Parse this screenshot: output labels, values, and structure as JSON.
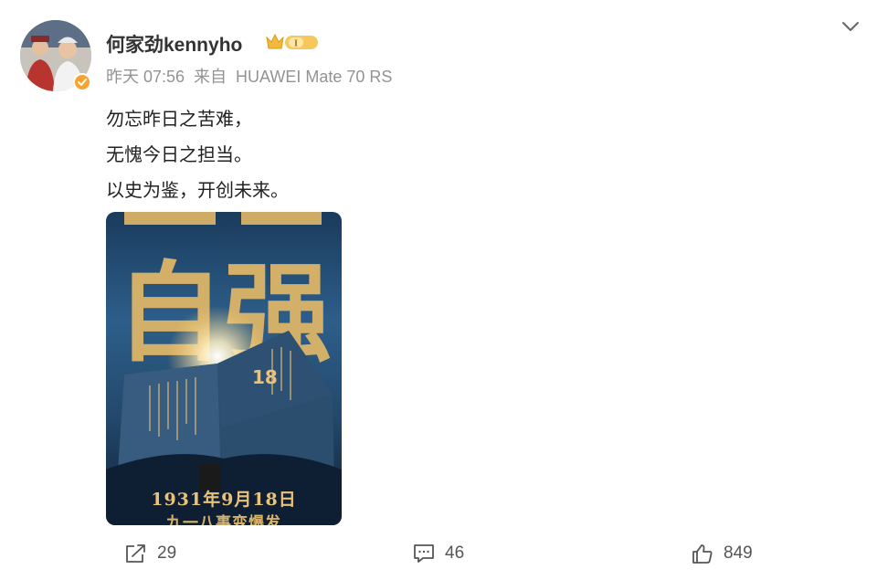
{
  "author": {
    "name": "何家劲kennyho",
    "avatar_icon": "avatar-photo",
    "verified_icon": "verified-check-icon",
    "level_badge": "I"
  },
  "meta": {
    "time": "昨天 07:56",
    "source_prefix": "来自",
    "source": "HUAWEI Mate 70 RS"
  },
  "post": {
    "lines": [
      "勿忘昨日之苦难，",
      "无愧今日之担当。",
      "以史为鉴，开创未来。"
    ]
  },
  "image": {
    "headline_chars": "自强",
    "caption_line1": "1931年9月18日",
    "caption_line2": "九一八事变爆发",
    "monument_number": "18"
  },
  "actions": {
    "share": {
      "icon": "share-icon",
      "count": "29"
    },
    "comment": {
      "icon": "comment-icon",
      "count": "46"
    },
    "like": {
      "icon": "thumbs-up-icon",
      "count": "849"
    }
  },
  "colors": {
    "badge_orange": "#f7a330",
    "poster_gold": "#e2b867",
    "meta_gray": "#939393"
  }
}
